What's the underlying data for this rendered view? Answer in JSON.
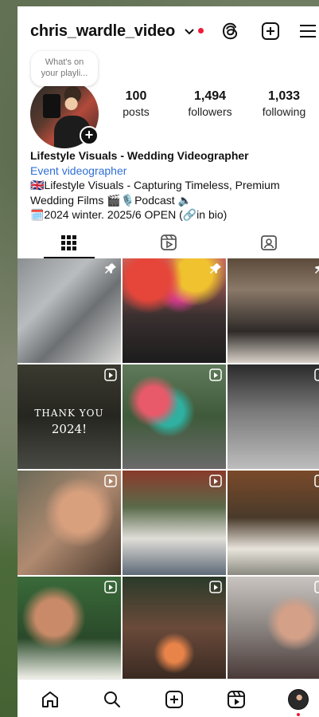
{
  "header": {
    "username": "chris_wardle_video",
    "note_line1": "What's on",
    "note_line2": "your playli..."
  },
  "stats": [
    {
      "value": "100",
      "label": "posts"
    },
    {
      "value": "1,494",
      "label": "followers"
    },
    {
      "value": "1,033",
      "label": "following"
    }
  ],
  "bio": {
    "name": "Lifestyle Visuals - Wedding Videographer",
    "category": "Event videographer",
    "line1": "🇬🇧Lifestyle Visuals - Capturing Timeless, Premium",
    "line2": "Wedding Films 🎬🎙️Podcast 🔈",
    "line3": "🗓️2024 winter. 2025/6 OPEN (🔗in bio)"
  },
  "tabs": [
    {
      "icon": "grid-icon"
    },
    {
      "icon": "reels-icon"
    },
    {
      "icon": "tagged-icon"
    }
  ],
  "grid": {
    "thank_you_line1": "THANK YOU",
    "thank_you_line2": "2024!"
  },
  "colors": {
    "link_blue": "#2f6fd4",
    "notification_red": "#ee1d38"
  },
  "bottom_nav": [
    {
      "icon": "home-icon"
    },
    {
      "icon": "search-icon"
    },
    {
      "icon": "create-icon"
    },
    {
      "icon": "reels-icon"
    },
    {
      "icon": "profile-avatar"
    }
  ]
}
